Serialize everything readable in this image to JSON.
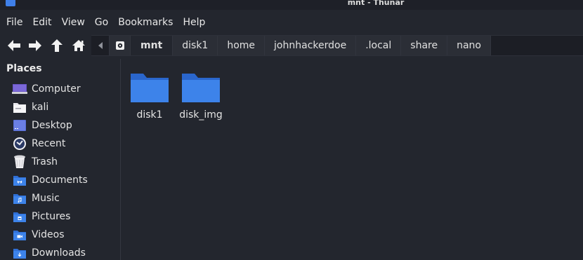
{
  "window": {
    "title": "mnt - Thunar"
  },
  "menubar": {
    "items": [
      "File",
      "Edit",
      "View",
      "Go",
      "Bookmarks",
      "Help"
    ]
  },
  "pathbar": {
    "crumbs": [
      "mnt",
      "disk1",
      "home",
      "johnhackerdoe",
      ".local",
      "share",
      "nano"
    ],
    "active_index": 0
  },
  "sidebar": {
    "heading": "Places",
    "items": [
      {
        "label": "Computer",
        "icon": "computer-icon"
      },
      {
        "label": "kali",
        "icon": "home-folder-icon"
      },
      {
        "label": "Desktop",
        "icon": "desktop-icon"
      },
      {
        "label": "Recent",
        "icon": "recent-icon"
      },
      {
        "label": "Trash",
        "icon": "trash-icon"
      },
      {
        "label": "Documents",
        "icon": "documents-folder-icon"
      },
      {
        "label": "Music",
        "icon": "music-folder-icon"
      },
      {
        "label": "Pictures",
        "icon": "pictures-folder-icon"
      },
      {
        "label": "Videos",
        "icon": "videos-folder-icon"
      },
      {
        "label": "Downloads",
        "icon": "downloads-folder-icon"
      }
    ]
  },
  "files": [
    {
      "name": "disk1",
      "icon": "folder-icon"
    },
    {
      "name": "disk_img",
      "icon": "folder-icon"
    }
  ],
  "colors": {
    "accent": "#3f7fe8",
    "background": "#23262e",
    "folder": "#3d83ea"
  }
}
